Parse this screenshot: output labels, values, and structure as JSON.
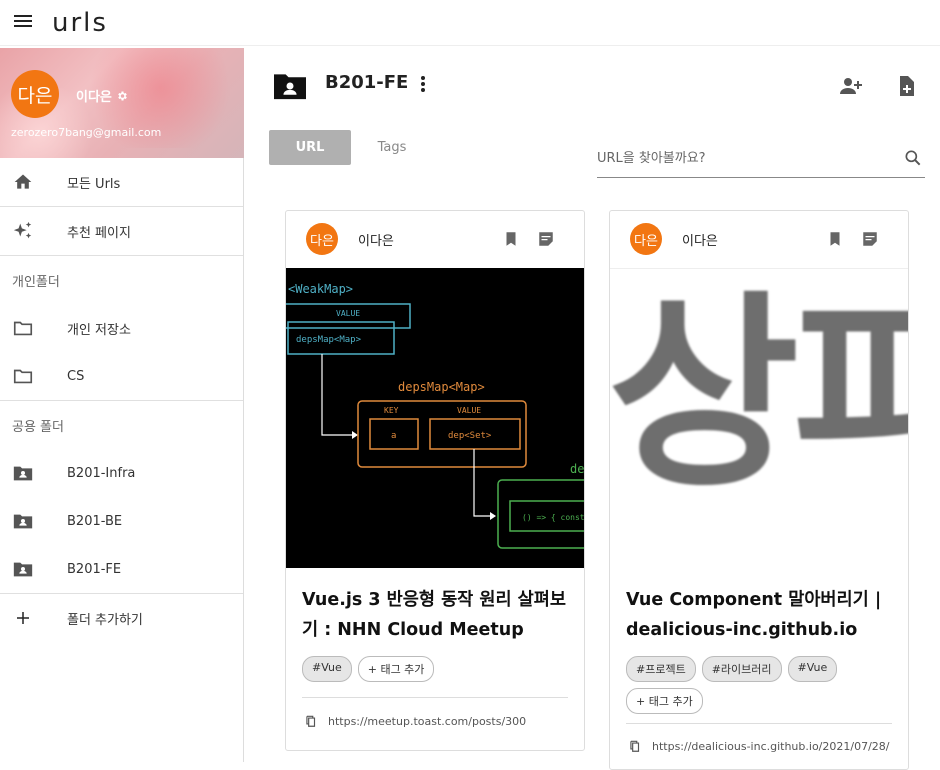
{
  "app": {
    "logo": "urls"
  },
  "profile": {
    "avatar_text": "다은",
    "name": "이다은",
    "email": "zerozero7bang@gmail.com"
  },
  "sidebar": {
    "items": [
      {
        "label": "모든 Urls",
        "icon": "home-icon"
      },
      {
        "label": "추천 페이지",
        "icon": "sparkle-icon"
      }
    ],
    "personal_section": "개인폴더",
    "personal_folders": [
      {
        "label": "개인 저장소",
        "icon": "folder-outline-icon"
      },
      {
        "label": "CS",
        "icon": "folder-outline-icon"
      }
    ],
    "shared_section": "공용 폴더",
    "shared_folders": [
      {
        "label": "B201-Infra",
        "icon": "shared-folder-icon"
      },
      {
        "label": "B201-BE",
        "icon": "shared-folder-icon"
      },
      {
        "label": "B201-FE",
        "icon": "shared-folder-icon"
      }
    ],
    "add_folder": "폴더 추가하기"
  },
  "main": {
    "folder_title": "B201-FE",
    "tabs": {
      "url": "URL",
      "tags": "Tags"
    },
    "search": {
      "placeholder": "URL을 찾아볼까요?"
    }
  },
  "cards": [
    {
      "avatar_text": "다은",
      "user": "이다은",
      "title": "Vue.js 3 반응형 동작 원리 살펴보기 : NHN Cloud Meetup",
      "tags": [
        "#Vue"
      ],
      "add_tag": "+ 태그 추가",
      "url": "https://meetup.toast.com/posts/300",
      "thumb_labels": {
        "weakmap": "<WeakMap>",
        "value": "VALUE",
        "depsmap_box": "depsMap<Map>",
        "depsmap_title": "depsMap<Map>",
        "key": "KEY",
        "value2": "VALUE",
        "a": "a",
        "dep": "dep<Set>",
        "effect": "() => { const s",
        "de": "de"
      }
    },
    {
      "avatar_text": "다은",
      "user": "이다은",
      "title": "Vue Component 말아버리기 | dealicious-inc.github.io",
      "tags": [
        "#프로젝트",
        "#라이브러리",
        "#Vue"
      ],
      "add_tag": "+ 태그 추가",
      "url": "https://dealicious-inc.github.io/2021/07/28/",
      "thumb_text": "상파"
    }
  ],
  "colors": {
    "avatar": "#f27612",
    "tab_active": "#b0b0b0",
    "teal": "#4fb0c6",
    "orange": "#e08a3c",
    "green": "#4caf50"
  }
}
